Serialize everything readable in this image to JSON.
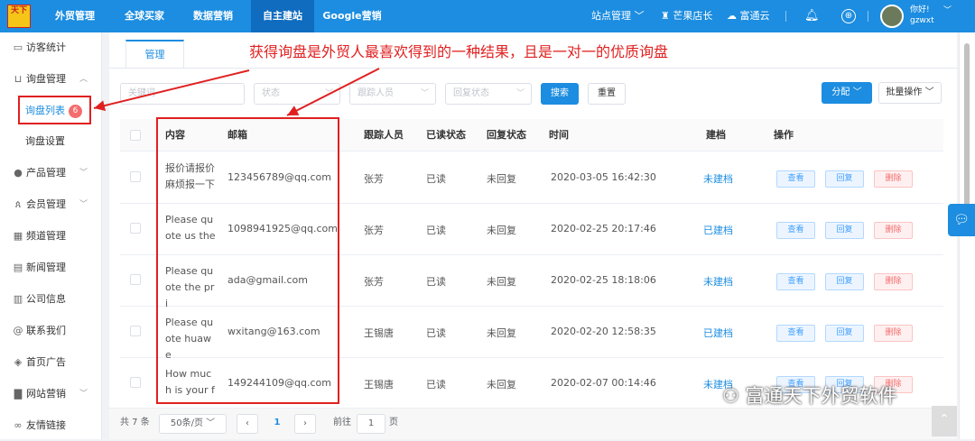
{
  "topbar": {
    "logo": "天下",
    "nav": [
      "外贸管理",
      "全球买家",
      "数据营销",
      "自主建站",
      "Google营销"
    ],
    "site_manage": "站点管理",
    "shop": "芒果店长",
    "cloud": "富通云",
    "greeting": "你好!",
    "username": "gzwxt",
    "colors": {
      "bar": "#1c8de0",
      "active": "#0f6cbf"
    }
  },
  "sidebar": {
    "items": [
      {
        "label": "访客统计",
        "icon": "monitor-icon"
      },
      {
        "label": "询盘管理",
        "icon": "cart-icon",
        "expanded": true
      },
      {
        "label": "询盘列表",
        "badge": "6",
        "active": true
      },
      {
        "label": "询盘设置"
      },
      {
        "label": "产品管理",
        "icon": "product-icon"
      },
      {
        "label": "会员管理",
        "icon": "members-icon"
      },
      {
        "label": "频道管理",
        "icon": "grid-icon"
      },
      {
        "label": "新闻管理",
        "icon": "news-icon"
      },
      {
        "label": "公司信息",
        "icon": "building-icon"
      },
      {
        "label": "联系我们",
        "icon": "at-icon"
      },
      {
        "label": "首页广告",
        "icon": "ad-icon"
      },
      {
        "label": "网站营销",
        "icon": "chart-icon"
      },
      {
        "label": "友情链接",
        "icon": "link-icon"
      }
    ]
  },
  "main": {
    "tab": "管理",
    "annotation": "获得询盘是外贸人最喜欢得到的一种结果，且是一对一的优质询盘",
    "filters": {
      "keyword": "关键词",
      "status": "状态",
      "follower": "跟踪人员",
      "reply_status": "回复状态",
      "search": "搜索",
      "reset": "重置",
      "assign": "分配",
      "batch": "批量操作"
    },
    "table": {
      "headers": [
        "内容",
        "邮箱",
        "跟踪人员",
        "已读状态",
        "回复状态",
        "时间",
        "建档",
        "操作"
      ],
      "rows": [
        {
          "content": "报价请报价麻烦报一下",
          "email": "123456789@qq.com",
          "follower": "张芳",
          "read": "已读",
          "reply": "未回复",
          "time": "2020-03-05 16:42:30",
          "archive": "未建档"
        },
        {
          "content": "Please quote us the",
          "email": "1098941925@qq.com",
          "follower": "张芳",
          "read": "已读",
          "reply": "未回复",
          "time": "2020-02-25 20:17:46",
          "archive": "已建档"
        },
        {
          "content": "Please quote the pri",
          "email": "ada@gmail.com",
          "follower": "张芳",
          "read": "已读",
          "reply": "未回复",
          "time": "2020-02-25 18:18:06",
          "archive": "未建档"
        },
        {
          "content": "Please quote huawe",
          "email": "wxitang@163.com",
          "follower": "王锡唐",
          "read": "已读",
          "reply": "未回复",
          "time": "2020-02-20 12:58:35",
          "archive": "已建档"
        },
        {
          "content": "How much is your f",
          "email": "149244109@qq.com",
          "follower": "王锡唐",
          "read": "已读",
          "reply": "未回复",
          "time": "2020-02-07 00:14:46",
          "archive": "未建档"
        }
      ],
      "actions": {
        "view": "查看",
        "reply": "回复",
        "delete": "删除"
      }
    },
    "pagination": {
      "total": "共 7 条",
      "page_size": "50条/页",
      "current": "1",
      "goto_label": "前往",
      "goto_value": "1",
      "page_unit": "页"
    }
  },
  "watermark": "富通天下外贸软件",
  "colors": {
    "annotation": "#e02020",
    "primary": "#1c8de0",
    "danger": "#f56c6c"
  }
}
